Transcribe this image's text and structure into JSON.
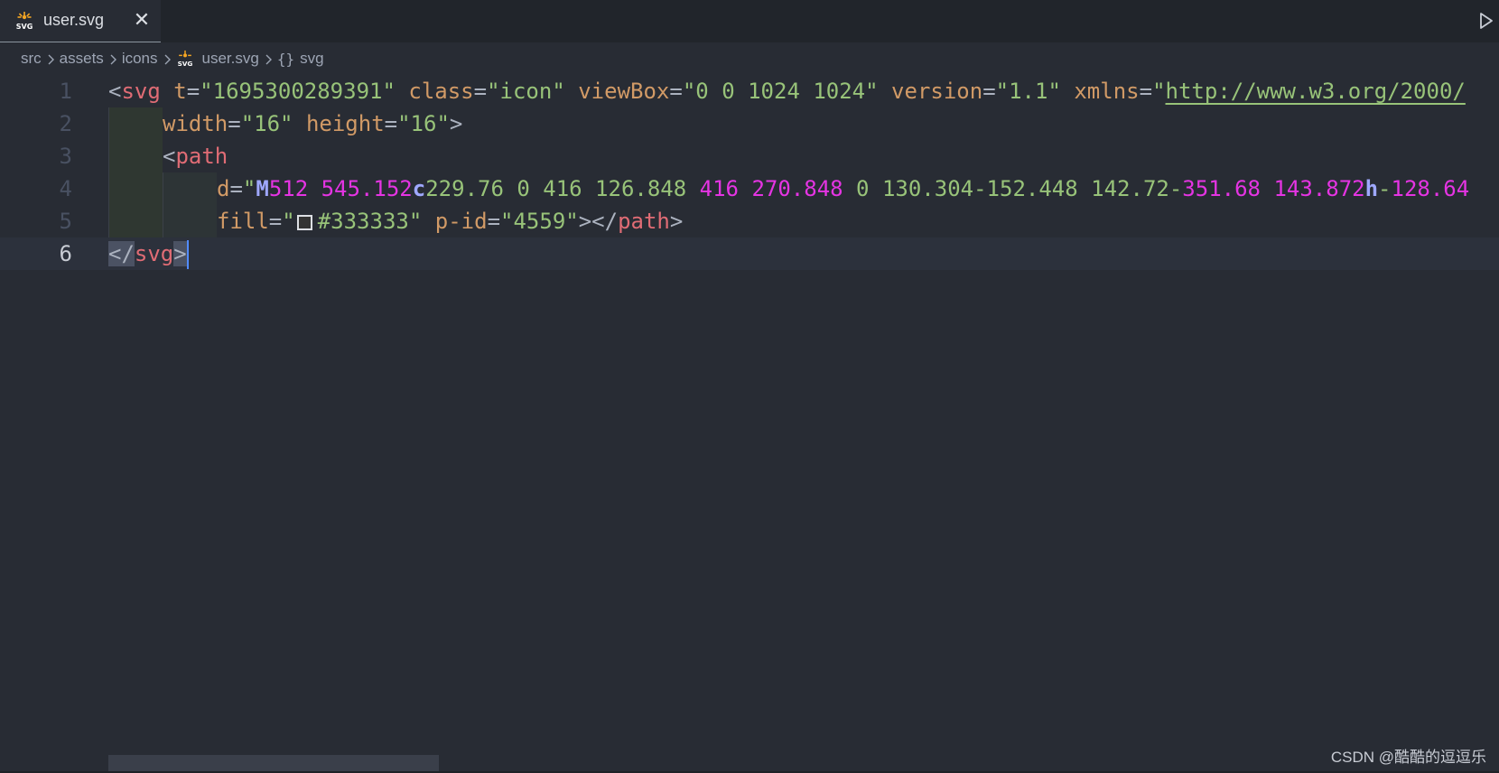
{
  "tab": {
    "label": "user.svg",
    "icon": "svg-file-icon",
    "close_glyph": "✕"
  },
  "breadcrumb": {
    "items": [
      "src",
      "assets",
      "icons",
      "user.svg",
      "svg"
    ],
    "symbol_glyph": "{}"
  },
  "editor": {
    "line_numbers": [
      "1",
      "2",
      "3",
      "4",
      "5",
      "6"
    ],
    "current_line": 6,
    "lines": {
      "l1": {
        "open": "<",
        "tag": "svg",
        "a1": "t",
        "eq": "=",
        "v1": "\"1695300289391\"",
        "a2": "class",
        "v2": "\"icon\"",
        "a3": "viewBox",
        "v3": "\"0 0 1024 1024\"",
        "a4": "version",
        "v4": "\"1.1\"",
        "a5": "xmlns",
        "q": "\"",
        "url": "http://www.w3.org/2000/"
      },
      "l2": {
        "a1": "width",
        "eq": "=",
        "v1": "\"16\"",
        "a2": "height",
        "v2": "\"16\"",
        "close": ">"
      },
      "l3": {
        "open": "<",
        "tag": "path"
      },
      "l4": {
        "a1": "d",
        "eq": "=",
        "q": "\"",
        "cmd_M": "M",
        "m_args": "512 545.152",
        "cmd_c": "c",
        "c_args": "229.76 0 416 126.848",
        "c_args2": "416 270.848",
        "rest1": " 0 130.304-152.448 142.72-",
        "hl1": "351.68 143.872",
        "cmd_h": "h",
        "rest2": "-",
        "hl2": "128.64"
      },
      "l5": {
        "a1": "fill",
        "eq": "=",
        "q": "\"",
        "color": "#333333",
        "q2": "\"",
        "a2": "p-id",
        "v2": "\"4559\"",
        "close": "></",
        "tag": "path",
        "end": ">"
      },
      "l6": {
        "open": "</",
        "tag": "svg",
        "close": ">"
      }
    }
  },
  "watermark": "CSDN @酷酷的逗逗乐",
  "colors": {
    "background": "#282c34",
    "tag": "#e06c75",
    "attribute": "#d19a66",
    "string": "#98c379",
    "number_highlight": "#e534e3",
    "path_command": "#9fa8ff",
    "cursor": "#528bff",
    "swatch_color": "#333333"
  }
}
